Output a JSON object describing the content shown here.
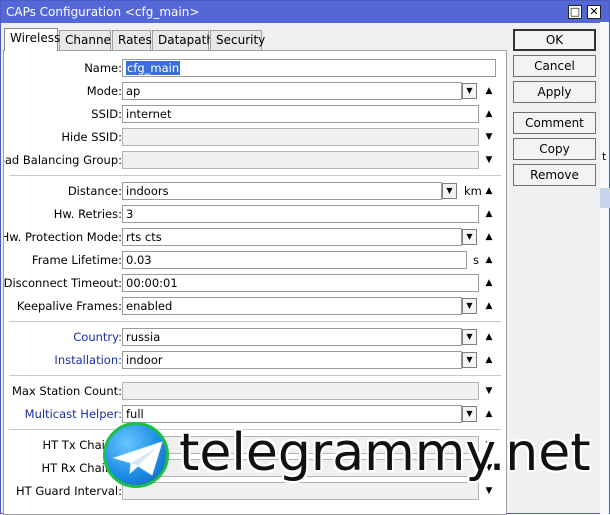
{
  "window": {
    "title": "CAPs Configuration <cfg_main>",
    "restore_glyph": "□",
    "close_glyph": "✕",
    "titlebar_color": "#5367d6"
  },
  "tabs": [
    {
      "label": "Wireless",
      "active": true
    },
    {
      "label": "Channel",
      "active": false
    },
    {
      "label": "Rates",
      "active": false
    },
    {
      "label": "Datapath",
      "active": false
    },
    {
      "label": "Security",
      "active": false
    }
  ],
  "form": {
    "name": {
      "label": "Name:",
      "value": "cfg_main"
    },
    "mode": {
      "label": "Mode:",
      "value": "ap"
    },
    "ssid": {
      "label": "SSID:",
      "value": "internet"
    },
    "hide_ssid": {
      "label": "Hide SSID:",
      "value": ""
    },
    "load_balancing_group": {
      "label": "Load Balancing Group:",
      "value": ""
    },
    "distance": {
      "label": "Distance:",
      "value": "indoors",
      "unit": "km"
    },
    "hw_retries": {
      "label": "Hw. Retries:",
      "value": "3"
    },
    "hw_protection_mode": {
      "label": "Hw. Protection Mode:",
      "value": "rts cts"
    },
    "frame_lifetime": {
      "label": "Frame Lifetime:",
      "value": "0.03",
      "unit": "s"
    },
    "disconnect_timeout": {
      "label": "Disconnect Timeout:",
      "value": "00:00:01"
    },
    "keepalive_frames": {
      "label": "Keepalive Frames:",
      "value": "enabled"
    },
    "country": {
      "label": "Country:",
      "value": "russia"
    },
    "installation": {
      "label": "Installation:",
      "value": "indoor"
    },
    "max_station_count": {
      "label": "Max Station Count:",
      "value": ""
    },
    "multicast_helper": {
      "label": "Multicast Helper:",
      "value": "full"
    },
    "ht_tx_chains": {
      "label": "HT Tx Chains:",
      "value": ""
    },
    "ht_rx_chains": {
      "label": "HT Rx Chains:",
      "value": ""
    },
    "ht_guard_interval": {
      "label": "HT Guard Interval:",
      "value": ""
    }
  },
  "glyphs": {
    "dropdown": "▼",
    "up": "▲",
    "down": "▼"
  },
  "buttons": {
    "ok": "OK",
    "cancel": "Cancel",
    "apply": "Apply",
    "comment": "Comment",
    "copy": "Copy",
    "remove": "Remove"
  },
  "background_fragments": {
    "frag1": "t"
  },
  "watermark": {
    "text": "telegrammy.net",
    "icon": "telegram-logo-icon"
  },
  "colors": {
    "label_blue": "#1a2fa8",
    "selection": "#3a6ed8"
  }
}
